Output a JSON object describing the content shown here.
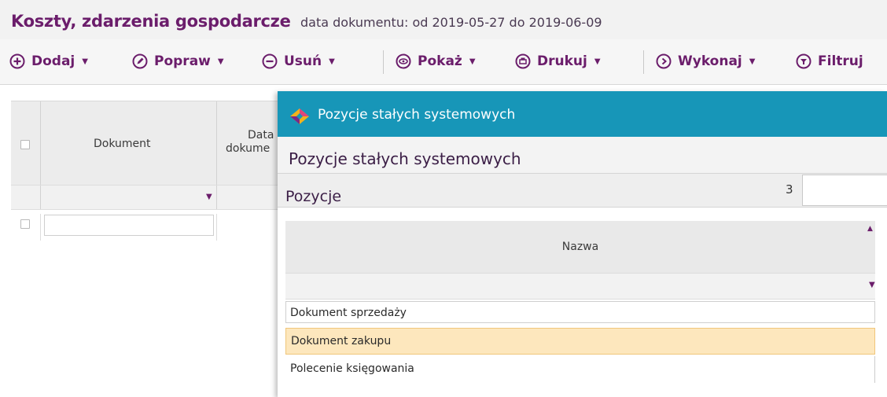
{
  "header": {
    "title": "Koszty, zdarzenia gospodarcze",
    "subtitle": "data dokumentu: od 2019-05-27 do 2019-06-09"
  },
  "toolbar": {
    "items": [
      {
        "label": "Dodaj",
        "icon": "plus-circle-icon"
      },
      {
        "label": "Popraw",
        "icon": "edit-circle-icon"
      },
      {
        "label": "Usuń",
        "icon": "minus-circle-icon"
      },
      {
        "label": "Pokaż",
        "icon": "eye-icon"
      },
      {
        "label": "Drukuj",
        "icon": "printer-icon"
      },
      {
        "label": "Wykonaj",
        "icon": "play-circle-icon"
      },
      {
        "label": "Filtruj",
        "icon": "filter-icon"
      }
    ]
  },
  "grid": {
    "columns": {
      "document": "Dokument",
      "date_line1": "Data",
      "date_line2": "dokume"
    }
  },
  "dialog": {
    "window_title": "Pozycje stałych systemowych",
    "heading": "Pozycje stałych systemowych",
    "section_title": "Pozycje",
    "count": "3",
    "list": {
      "column_header": "Nazwa",
      "rows": [
        "Dokument sprzedaży",
        "Dokument zakupu",
        "Polecenie księgowania"
      ],
      "selected_row": "Dokument zakupu"
    }
  },
  "colors": {
    "accent": "#6b1d6b",
    "dialog_titlebar": "#1796b8",
    "selected_row": "#fde7bd"
  }
}
